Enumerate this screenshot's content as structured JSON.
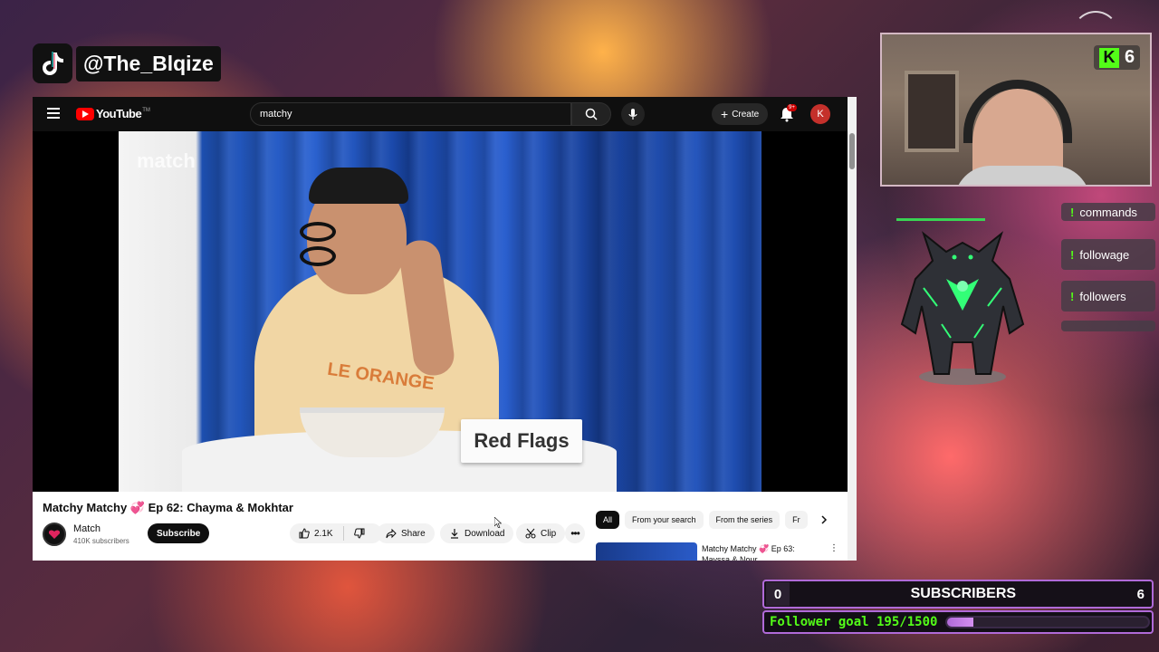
{
  "overlay": {
    "tiktok_handle": "@The_Blqize",
    "kick_viewers": "6",
    "bot_commands": [
      "commands",
      "followage",
      "followers"
    ],
    "subscribers": {
      "left": "0",
      "label": "SUBSCRIBERS",
      "right": "6"
    },
    "follower_goal": {
      "text": "Follower goal 195/1500",
      "current": 195,
      "target": 1500
    }
  },
  "youtube": {
    "search_query": "matchy",
    "create_label": "Create",
    "notification_badge": "9+",
    "avatar_letter": "K",
    "logo_text": "YouTube",
    "video": {
      "title": "Matchy Matchy 💞 Ep 62: Chayma & Mokhtar",
      "card_text": "Red Flags",
      "watermark": "match"
    },
    "channel": {
      "name": "Match",
      "subscribers": "410K subscribers",
      "subscribe_label": "Subscribe"
    },
    "actions": {
      "likes": "2.1K",
      "share": "Share",
      "download": "Download",
      "clip": "Clip"
    },
    "chips": [
      "All",
      "From your search",
      "From the series",
      "Fr"
    ],
    "recommendation": {
      "title": "Matchy Matchy 💞 Ep 63: Mayssa & Nour"
    }
  },
  "colors": {
    "youtube_red": "#ff0000",
    "kick_green": "#53fc18",
    "goal_purple": "#b06ad8"
  },
  "icons": [
    "tiktok-icon",
    "menu-icon",
    "youtube-logo-icon",
    "search-icon",
    "mic-icon",
    "plus-icon",
    "bell-icon",
    "like-icon",
    "dislike-icon",
    "share-icon",
    "download-icon",
    "scissors-icon",
    "more-icon",
    "chevron-right-icon",
    "kick-icon"
  ]
}
